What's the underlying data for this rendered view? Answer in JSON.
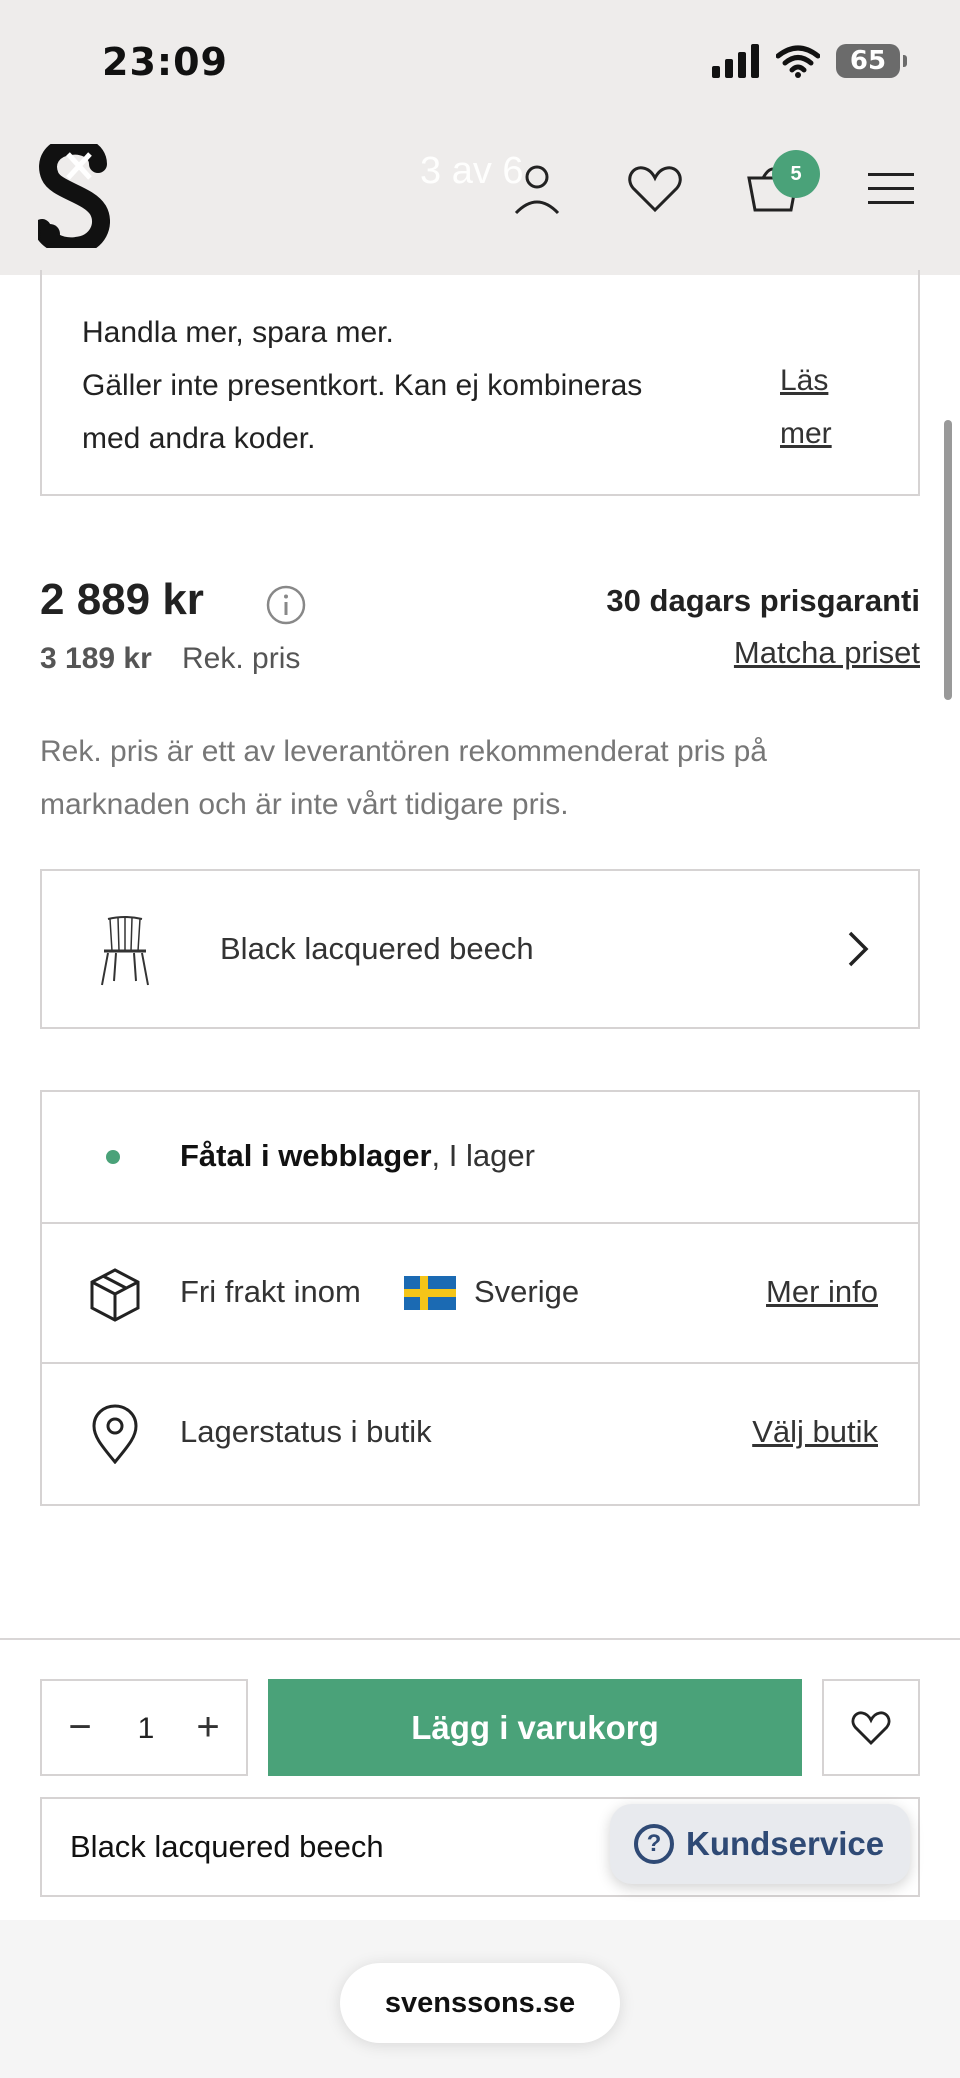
{
  "status_bar": {
    "time": "23:09",
    "battery": "65"
  },
  "header": {
    "page_counter": "3 av 6",
    "cart_count": "5"
  },
  "promo": {
    "line1": "Handla mer, spara mer.",
    "line2": "Gäller inte presentkort. Kan ej kombineras",
    "line3": "med andra koder.",
    "read_more": "Läs mer"
  },
  "pricing": {
    "price": "2 889 kr",
    "old_price": "3 189 kr",
    "rek_label": "Rek. pris",
    "guarantee": "30 dagars prisgaranti",
    "match_link": "Matcha priset",
    "disclaimer": "Rek. pris är ett av leverantören rekommenderat pris på marknaden och är inte vårt tidigare pris."
  },
  "variant": {
    "label": "Black lacquered beech"
  },
  "stock": {
    "web_status_bold": "Fåtal i webblager",
    "web_status_rest": ", I lager",
    "shipping_text": "Fri frakt inom",
    "shipping_country": "Sverige",
    "shipping_link": "Mer info",
    "store_text": "Lagerstatus i butik",
    "store_link": "Välj butik"
  },
  "purchase": {
    "quantity": "1",
    "minus": "−",
    "plus": "+",
    "add_to_cart": "Lägg i varukorg",
    "variant_summary": "Black lacquered beech",
    "support": "Kundservice",
    "support_icon": "?"
  },
  "browser": {
    "url": "svenssons.se"
  },
  "colors": {
    "accent": "#4aa279",
    "support": "#2f4a75"
  }
}
